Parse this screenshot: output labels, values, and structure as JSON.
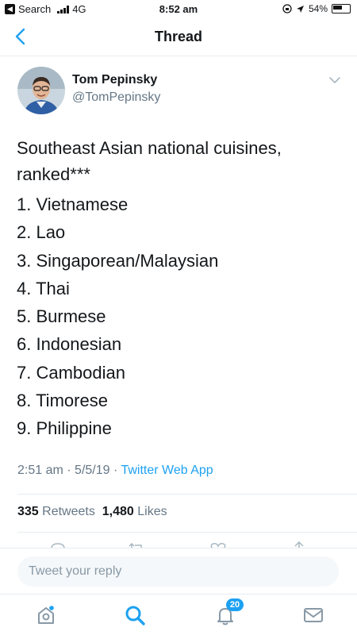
{
  "status_bar": {
    "back_label": "Search",
    "network": "4G",
    "time": "8:52 am",
    "battery": "54%"
  },
  "header": {
    "title": "Thread"
  },
  "tweet": {
    "author_name": "Tom Pepinsky",
    "author_handle": "@TomPepinsky",
    "intro": "Southeast Asian national cuisines, ranked***",
    "ranking": [
      "1. Vietnamese",
      "2. Lao",
      "3. Singaporean/Malaysian",
      "4. Thai",
      "5. Burmese",
      "6. Indonesian",
      "7. Cambodian",
      "8. Timorese",
      "9. Philippine"
    ],
    "time": "2:51 am",
    "date": "5/5/19",
    "separator": "·",
    "source": "Twitter Web App",
    "retweets_count": "335",
    "retweets_label": "Retweets",
    "likes_count": "1,480",
    "likes_label": "Likes"
  },
  "reply": {
    "placeholder": "Tweet your reply"
  },
  "tab_bar": {
    "tabs": [
      "home-icon",
      "search-icon",
      "notifications-icon",
      "messages-icon"
    ],
    "notification_badge": "20"
  },
  "colors": {
    "accent": "#1da1f2",
    "secondary_text": "#657786",
    "divider": "#e6ecf0"
  }
}
